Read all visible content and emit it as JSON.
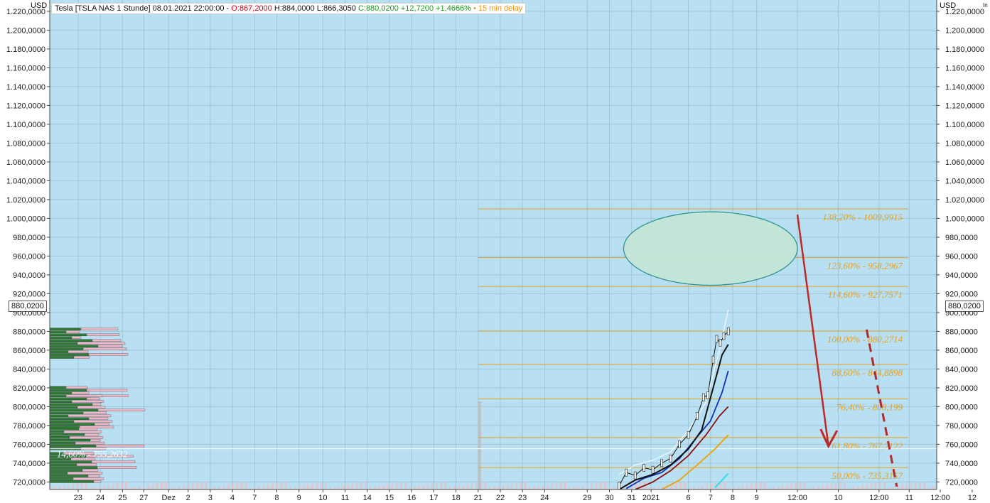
{
  "header": {
    "instrument": "Tesla [TSLA NAS 1 Stunde] 08.01.2021 22:00:00 -",
    "open": "O:867,2000",
    "high": "H:884,0000",
    "low": "L:866,3050",
    "close_change": "C:880,0200 +12,7200 +1,4666%",
    "delay": "• 15 min delay"
  },
  "unit_left": "USD",
  "unit_right": "USD",
  "unit_right_small": "In",
  "last_price_tag": "880,0200",
  "colors": {
    "plot_bg": "#b8e0f2",
    "grid": "#9fc6d8",
    "fib_line": "#e8a020",
    "ellipse_fill": "#c4e6d6",
    "ellipse_stroke": "#1f8c86",
    "arrow": "#c02828",
    "dashed_arrow": "#b22a2a",
    "ma_black": "#111111",
    "ma_blue": "#1430b8",
    "ma_darkred": "#8b1010",
    "ma_orange": "#f0a000",
    "ma_cyan": "#28e0e8",
    "ma_white": "#ffffff",
    "volume_profile_green": "#2e7d32",
    "volume_profile_pink": "#f0b8c6"
  },
  "chart_data": {
    "type": "candlestick",
    "instrument": "Tesla [TSLA NAS 1 Stunde]",
    "ylim": [
      712,
      1232
    ],
    "y_ticks": [
      720,
      740,
      760,
      780,
      800,
      820,
      840,
      860,
      880,
      900,
      920,
      940,
      960,
      980,
      1000,
      1020,
      1040,
      1060,
      1080,
      1100,
      1120,
      1140,
      1160,
      1180,
      1200,
      1220
    ],
    "y_tick_labels": [
      "720,0000",
      "740,0000",
      "760,0000",
      "780,0000",
      "800,0000",
      "820,0000",
      "840,0000",
      "860,0000",
      "880,0000",
      "900,0000",
      "920,0000",
      "940,0000",
      "960,0000",
      "980,0000",
      "1.000,0000",
      "1.020,0000",
      "1.040,0000",
      "1.060,0000",
      "1.080,0000",
      "1.100,0000",
      "1.120,0000",
      "1.140,0000",
      "1.160,0000",
      "1.180,0000",
      "1.200,0000",
      "1.220,0000"
    ],
    "x_tick_labels": [
      "23",
      "24",
      "25",
      "27",
      "Dez",
      "2",
      "3",
      "4",
      "7",
      "8",
      "9",
      "10",
      "11",
      "14",
      "15",
      "16",
      "17",
      "18",
      "21",
      "22",
      "23",
      "24",
      "29",
      "30",
      "31",
      "2021",
      "6",
      "7",
      "8",
      "9",
      "12:00",
      "10",
      "12:00",
      "11",
      "12:00",
      "12"
    ],
    "x_tick_pos": [
      0.032,
      0.057,
      0.082,
      0.106,
      0.134,
      0.156,
      0.181,
      0.206,
      0.231,
      0.256,
      0.281,
      0.308,
      0.333,
      0.358,
      0.383,
      0.408,
      0.433,
      0.458,
      0.483,
      0.508,
      0.533,
      0.558,
      0.606,
      0.631,
      0.656,
      0.678,
      0.72,
      0.745,
      0.77,
      0.797,
      0.843,
      0.889,
      0.935,
      0.969,
      1.004,
      1.04
    ],
    "last_close": 880.02,
    "fibonacci_levels": [
      {
        "label": "138,20% - 1009,9915",
        "value": 1009.9915
      },
      {
        "label": "123,60% - 958,2967",
        "value": 958.2967
      },
      {
        "label": "114,60% - 927,7571",
        "value": 927.7571
      },
      {
        "label": "100,00% - 880,2714",
        "value": 880.2714
      },
      {
        "label": "88,60% - 844,8898",
        "value": 844.8898
      },
      {
        "label": "76,40% - 808,199",
        "value": 808.199
      },
      {
        "label": "61,80% - 767,2122",
        "value": 767.2122
      },
      {
        "label": "50,00% - 735,3157",
        "value": 735.3157
      }
    ],
    "extra_level": {
      "label": "14,60% - 755,2632",
      "value": 755.2632
    },
    "target_zone": {
      "x_center": 0.745,
      "y_center": 968,
      "x_radius": 0.098,
      "y_radius": 39
    },
    "arrow_solid": {
      "from": [
        0.843,
        1004
      ],
      "to": [
        0.878,
        758
      ]
    },
    "arrow_dashed": {
      "from": [
        0.921,
        882
      ],
      "to": [
        0.955,
        715
      ]
    },
    "price_path": [
      [
        0.642,
        716
      ],
      [
        0.65,
        730
      ],
      [
        0.66,
        727
      ],
      [
        0.67,
        735
      ],
      [
        0.68,
        733
      ],
      [
        0.69,
        740
      ],
      [
        0.7,
        745
      ],
      [
        0.71,
        760
      ],
      [
        0.72,
        770
      ],
      [
        0.73,
        790
      ],
      [
        0.737,
        810
      ],
      [
        0.742,
        812
      ],
      [
        0.748,
        850
      ],
      [
        0.752,
        872
      ],
      [
        0.756,
        868
      ],
      [
        0.76,
        875
      ],
      [
        0.765,
        880
      ]
    ],
    "ma_black": [
      [
        0.642,
        712
      ],
      [
        0.66,
        722
      ],
      [
        0.68,
        728
      ],
      [
        0.7,
        738
      ],
      [
        0.72,
        755
      ],
      [
        0.735,
        775
      ],
      [
        0.748,
        820
      ],
      [
        0.758,
        855
      ],
      [
        0.765,
        866
      ]
    ],
    "ma_blue": [
      [
        0.65,
        713
      ],
      [
        0.67,
        724
      ],
      [
        0.69,
        730
      ],
      [
        0.71,
        745
      ],
      [
        0.73,
        768
      ],
      [
        0.745,
        785
      ],
      [
        0.758,
        815
      ],
      [
        0.765,
        838
      ]
    ],
    "ma_darkred": [
      [
        0.66,
        712
      ],
      [
        0.68,
        720
      ],
      [
        0.7,
        732
      ],
      [
        0.72,
        748
      ],
      [
        0.74,
        770
      ],
      [
        0.755,
        790
      ],
      [
        0.765,
        800
      ]
    ],
    "ma_orange": [
      [
        0.69,
        712
      ],
      [
        0.71,
        722
      ],
      [
        0.73,
        738
      ],
      [
        0.75,
        755
      ],
      [
        0.765,
        770
      ]
    ],
    "ma_cyan": [
      [
        0.75,
        714
      ],
      [
        0.758,
        722
      ],
      [
        0.765,
        729
      ]
    ],
    "ma_white": [
      [
        0.642,
        728
      ],
      [
        0.66,
        738
      ],
      [
        0.68,
        743
      ],
      [
        0.7,
        752
      ],
      [
        0.72,
        775
      ],
      [
        0.74,
        805
      ],
      [
        0.755,
        860
      ],
      [
        0.765,
        903
      ]
    ],
    "volume_spike": {
      "x": 0.483,
      "height": 0.18
    }
  }
}
